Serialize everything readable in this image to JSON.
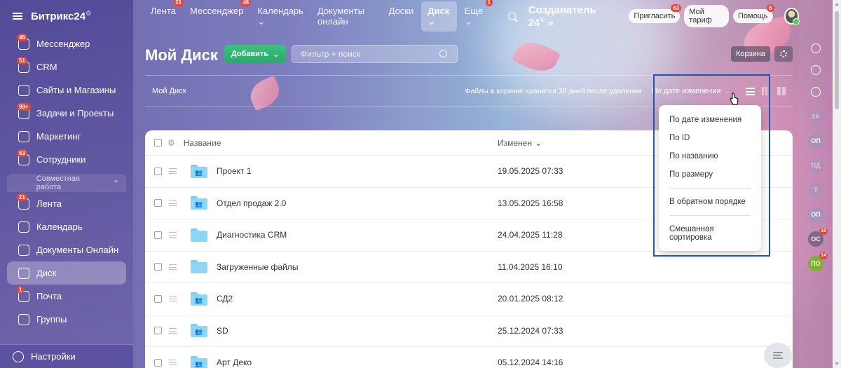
{
  "app": {
    "logo_text": "Битрикс24",
    "logo_mark": "©"
  },
  "sidebar": {
    "items": [
      {
        "label": "Мессенджер",
        "badge": "46",
        "icon": "chat-icon"
      },
      {
        "label": "CRM",
        "badge": "51",
        "icon": "crm-filter-icon"
      },
      {
        "label": "Сайты и Магазины",
        "badge": "",
        "icon": "cart-icon"
      },
      {
        "label": "Задачи и Проекты",
        "badge": "99+",
        "icon": "tasks-icon"
      },
      {
        "label": "Маркетинг",
        "badge": "",
        "icon": "target-icon"
      },
      {
        "label": "Сотрудники",
        "badge": "63",
        "icon": "people-icon"
      }
    ],
    "group_label": "Совместная работа",
    "group_items": [
      {
        "label": "Лента",
        "badge": "21",
        "icon": "feed-icon"
      },
      {
        "label": "Календарь",
        "badge": "",
        "icon": "calendar-icon"
      },
      {
        "label": "Документы Онлайн",
        "badge": "",
        "icon": "document-icon"
      },
      {
        "label": "Диск",
        "badge": "",
        "icon": "folder-icon",
        "active": true
      },
      {
        "label": "Почта",
        "badge": "1",
        "icon": "mail-icon"
      },
      {
        "label": "Группы",
        "badge": "",
        "icon": "group-icon"
      }
    ],
    "settings_label": "Настройки"
  },
  "topbar": {
    "tabs": [
      {
        "label": "Лента",
        "badge": "21"
      },
      {
        "label": "Мессенджер",
        "badge": "46"
      },
      {
        "label": "Календарь ⌄",
        "badge": ""
      },
      {
        "label": "Документы онлайн",
        "badge": ""
      },
      {
        "label": "Доски",
        "badge": ""
      },
      {
        "label": "Диск ⌄",
        "badge": "",
        "active": true
      },
      {
        "label": "Еще ⌄",
        "badge": "1"
      }
    ],
    "brand": "Создаватель 24",
    "brand_mark": "©",
    "invite_label": "Пригласить",
    "invite_badge": "63",
    "tariff_label": "Мой тариф",
    "help_label": "Помощь",
    "help_badge": "8"
  },
  "page": {
    "title": "Мой Диск",
    "add_button": "Добавить",
    "filter_placeholder": "Фильтр + поиск",
    "trash_button": "Корзина",
    "breadcrumb": "Мой Диск",
    "trash_note": "Файлы в корзине хранятся 30 дней после удаления",
    "sort_selected": "По дате изменения"
  },
  "table": {
    "col_name": "Название",
    "col_modified": "Изменен",
    "rows": [
      {
        "name": "Проект 1",
        "date": "19.05.2025 07:33",
        "shared": true
      },
      {
        "name": "Отдел продаж 2.0",
        "date": "13.05.2025 16:58",
        "shared": true
      },
      {
        "name": "Диагностика CRM",
        "date": "24.04.2025 11:28",
        "shared": false
      },
      {
        "name": "Загруженные файлы",
        "date": "11.04.2025 16:10",
        "shared": false
      },
      {
        "name": "СД2",
        "date": "20.01.2025 08:12",
        "shared": true
      },
      {
        "name": "SD",
        "date": "25.12.2024 07:33",
        "shared": true
      },
      {
        "name": "Арт Деко",
        "date": "05.12.2024 14:16",
        "shared": true
      }
    ]
  },
  "sort_menu": {
    "options": [
      "По дате изменения",
      "По ID",
      "По названию",
      "По размеру"
    ],
    "reverse": "В обратном порядке",
    "mixed": "Смешанная сортировка"
  },
  "rail": {
    "avatars": [
      {
        "text": "2А",
        "badge": "",
        "style": "dim"
      },
      {
        "text": "ОП",
        "badge": "",
        "style": ""
      },
      {
        "text": "ПД",
        "badge": "",
        "style": "dim"
      },
      {
        "text": "Т",
        "badge": "",
        "style": "dim"
      },
      {
        "text": "ОП",
        "badge": "",
        "style": ""
      },
      {
        "text": "ОС",
        "badge": "10",
        "style": "dark"
      },
      {
        "text": "ПО",
        "badge": "14",
        "style": "green"
      }
    ]
  },
  "colors": {
    "accent_green": "#2aa96a",
    "badge_red": "#e5463a",
    "highlight_blue": "#1f55b3"
  }
}
